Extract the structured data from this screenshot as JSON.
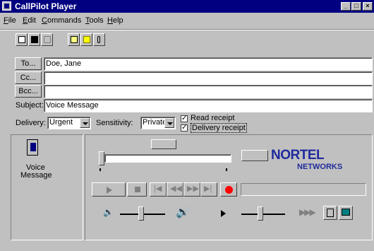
{
  "window": {
    "title": "CallPilot Player"
  },
  "menu": [
    {
      "label": "File",
      "u": "F",
      "rest": "ile"
    },
    {
      "label": "Edit",
      "u": "E",
      "rest": "dit"
    },
    {
      "label": "Commands",
      "u": "C",
      "rest": "ommands"
    },
    {
      "label": "Tools",
      "u": "T",
      "rest": "ools"
    },
    {
      "label": "Help",
      "u": "H",
      "rest": "elp"
    }
  ],
  "address": {
    "to_label": "To...",
    "to_value": "Doe, Jane",
    "cc_label": "Cc...",
    "cc_value": "",
    "bcc_label": "Bcc...",
    "bcc_value": "",
    "subject_label": "Subject:",
    "subject_value": "Voice Message"
  },
  "options": {
    "delivery_label": "Delivery:",
    "delivery_value": "Urgent",
    "sensitivity_label": "Sensitivity:",
    "sensitivity_value": "Private",
    "read_receipt_label": "Read receipt",
    "read_receipt_checked": true,
    "delivery_receipt_label": "Delivery receipt",
    "delivery_receipt_checked": true
  },
  "attachment": {
    "label_line1": "Voice",
    "label_line2": "Message"
  },
  "logo": {
    "line1": "NORTEL",
    "line2": "NETWORKS",
    "color": "#1f2a9c"
  },
  "colors": {
    "record": "#ff0000",
    "title_bar": "#000080"
  }
}
